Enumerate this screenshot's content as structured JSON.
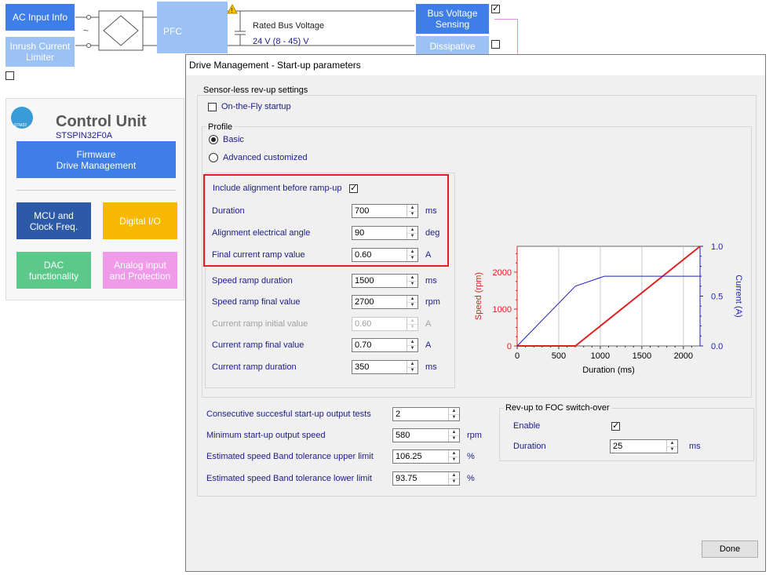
{
  "background": {
    "ac_input": "AC Input Info",
    "inrush": "Inrush Current\nLimiter",
    "pfc": "PFC",
    "rated_bus_voltage": "Rated Bus Voltage",
    "bus_voltage_value": "24 V (8 - 45) V",
    "bus_voltage_sensing": "Bus Voltage\nSensing",
    "dissipative": "Dissipative",
    "control_unit": {
      "title": "Control Unit",
      "mcu_name": "STSPIN32F0A",
      "logo_text": "STM32",
      "firmware": "Firmware\nDrive Management",
      "mcu_clock": "MCU and\nClock Freq.",
      "digital_io": "Digital I/O",
      "dac": "DAC\nfunctionality",
      "analog": "Analog input\nand Protection"
    }
  },
  "dialog": {
    "title": "Drive Management - Start-up parameters",
    "sensorless_group": "Sensor-less rev-up settings",
    "on_the_fly": "On-the-Fly startup",
    "profile_group": "Profile",
    "profile_basic": "Basic",
    "profile_advanced": "Advanced customized",
    "include_alignment": "Include alignment before ramp-up",
    "fields": {
      "duration": {
        "label": "Duration",
        "value": "700",
        "unit": "ms"
      },
      "align_angle": {
        "label": "Alignment electrical angle",
        "value": "90",
        "unit": "deg"
      },
      "final_current_ramp": {
        "label": "Final current ramp value",
        "value": "0.60",
        "unit": "A"
      },
      "speed_ramp_duration": {
        "label": "Speed ramp duration",
        "value": "1500",
        "unit": "ms"
      },
      "speed_ramp_final": {
        "label": "Speed ramp final value",
        "value": "2700",
        "unit": "rpm"
      },
      "current_ramp_initial": {
        "label": "Current ramp initial value",
        "value": "0.60",
        "unit": "A"
      },
      "current_ramp_final": {
        "label": "Current ramp final value",
        "value": "0.70",
        "unit": "A"
      },
      "current_ramp_duration": {
        "label": "Current ramp duration",
        "value": "350",
        "unit": "ms"
      },
      "consecutive_tests": {
        "label": "Consecutive succesful start-up output tests",
        "value": "2",
        "unit": ""
      },
      "min_startup_speed": {
        "label": "Minimum start-up output speed",
        "value": "580",
        "unit": "rpm"
      },
      "band_upper": {
        "label": "Estimated speed Band tolerance upper limit",
        "value": "106.25",
        "unit": "%"
      },
      "band_lower": {
        "label": "Estimated speed Band tolerance lower limit",
        "value": "93.75",
        "unit": "%"
      },
      "foc_duration": {
        "label": "Duration",
        "value": "25",
        "unit": "ms"
      }
    },
    "revup_group": "Rev-up to FOC switch-over",
    "enable": "Enable",
    "done": "Done",
    "arrow_up": "▲",
    "arrow_down": "▼"
  },
  "chart_data": {
    "type": "line",
    "xlabel": "Duration (ms)",
    "ylabel": "Speed (rpm)",
    "y2label": "Current (A)",
    "xlim": [
      0,
      2200
    ],
    "ylim": [
      0,
      2700
    ],
    "y2lim": [
      0,
      1.0
    ],
    "xticks": [
      "0",
      "500",
      "1000",
      "1500",
      "2000"
    ],
    "yticks": [
      "0",
      "1000",
      "2000"
    ],
    "y2ticks": [
      "0.0",
      "0.5",
      "1.0"
    ],
    "series": [
      {
        "axis": "left",
        "color": "#e02020",
        "x": [
          0,
          700,
          2200
        ],
        "y": [
          0,
          0,
          2700
        ]
      },
      {
        "axis": "right",
        "color": "#2020c0",
        "x": [
          0,
          700,
          1050,
          2200
        ],
        "y": [
          0,
          0.6,
          0.7,
          0.7
        ]
      }
    ]
  }
}
